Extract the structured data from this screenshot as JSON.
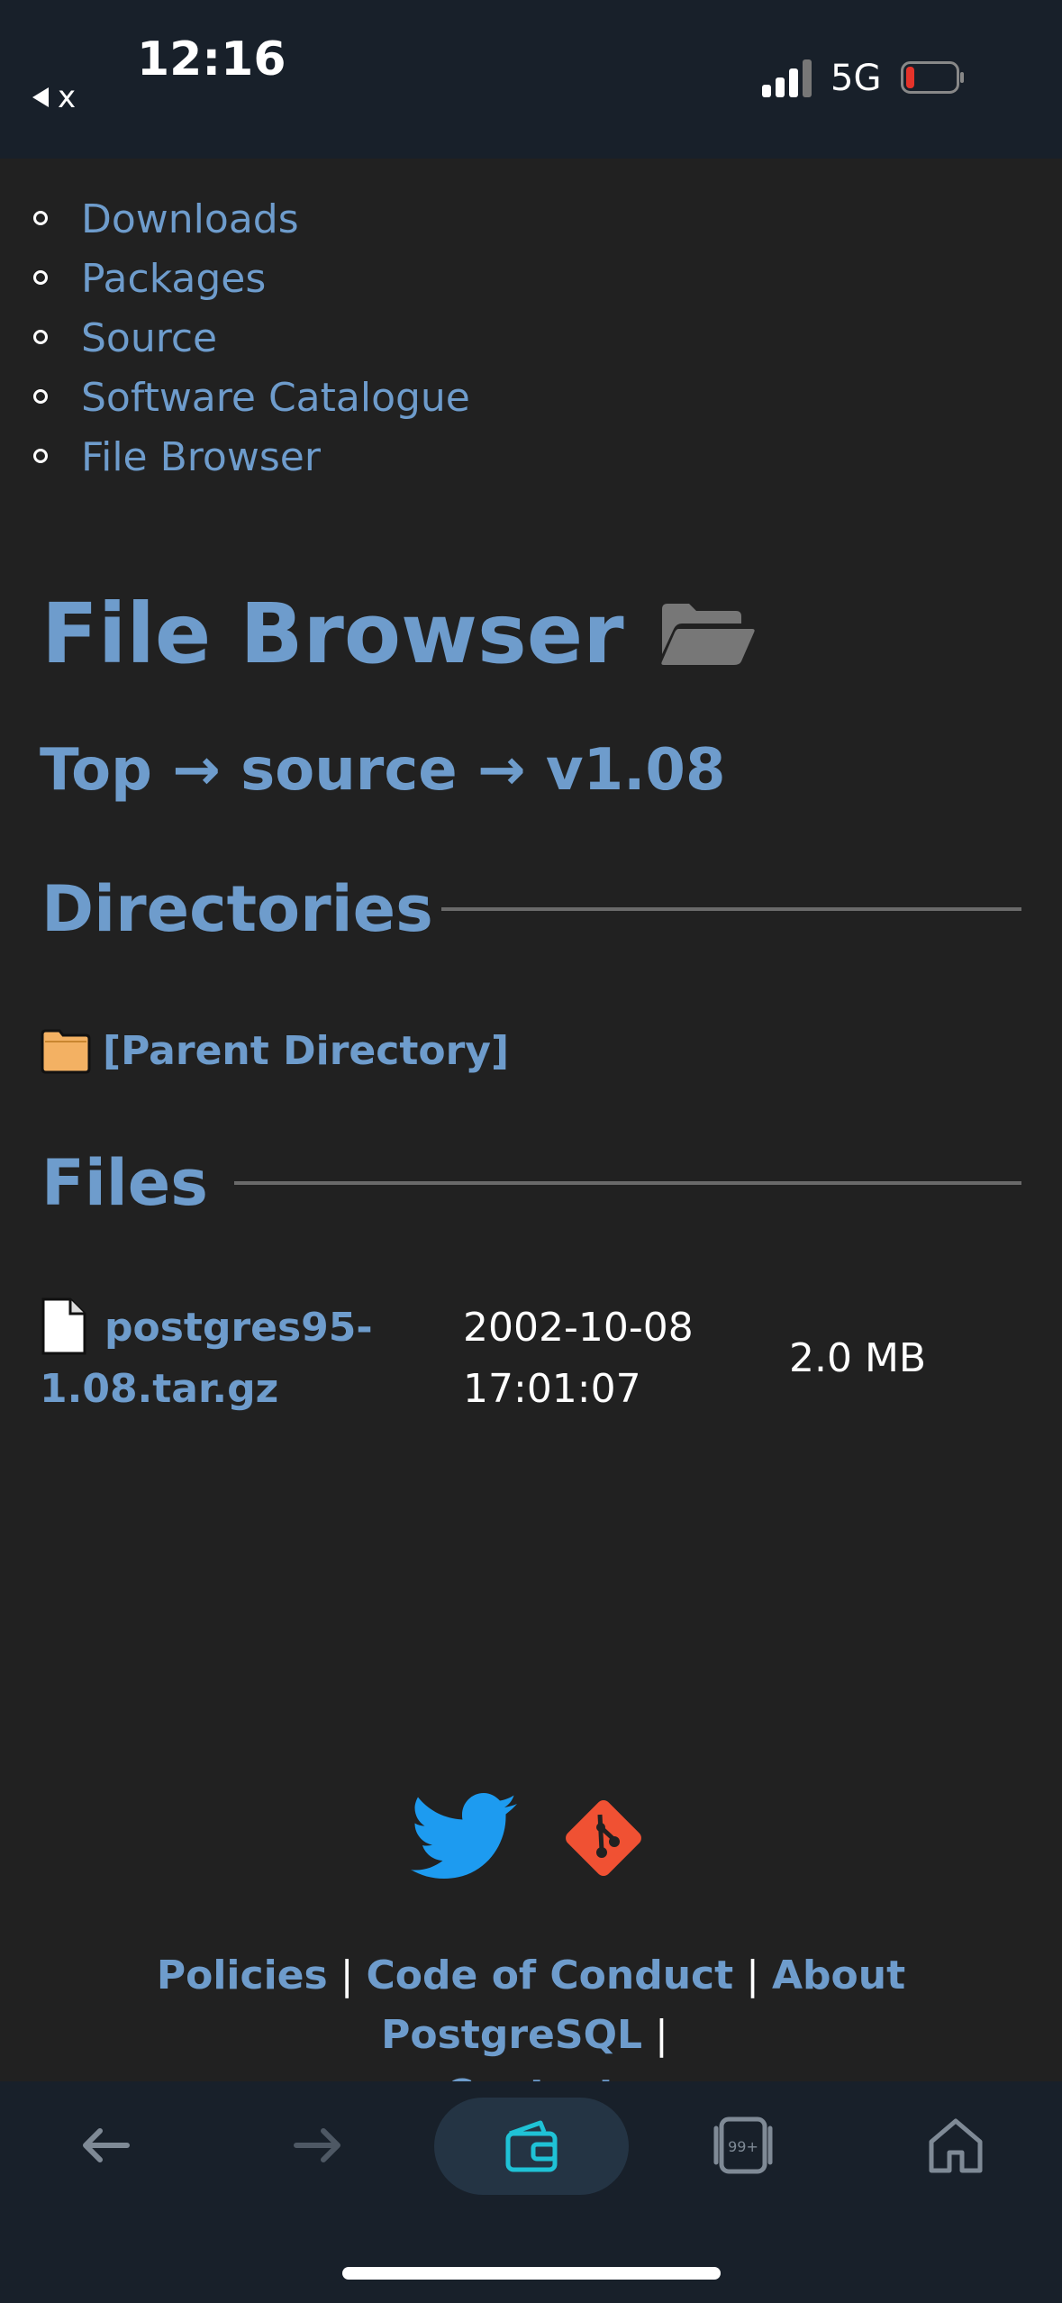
{
  "status_bar": {
    "back_label": "x",
    "time": "12:16",
    "network": "5G"
  },
  "nav": {
    "items": [
      {
        "label": "Downloads"
      },
      {
        "label": "Packages"
      },
      {
        "label": "Source"
      },
      {
        "label": "Software Catalogue"
      },
      {
        "label": "File Browser"
      }
    ]
  },
  "page": {
    "title": "File Browser",
    "breadcrumb": {
      "top": "Top",
      "source": "source",
      "current": "v1.08",
      "arrow": "→"
    }
  },
  "directories": {
    "heading": "Directories",
    "parent_label": "[Parent Directory]"
  },
  "files": {
    "heading": "Files",
    "rows": [
      {
        "name": "postgres95-1.08.tar.gz",
        "date": "2002-10-08 17:01:07",
        "size": "2.0 MB"
      }
    ]
  },
  "footer": {
    "policies": "Policies",
    "code_of_conduct": "Code of Conduct",
    "about": "About PostgreSQL",
    "contact": "Contact",
    "separator": "|"
  },
  "browser_bar": {
    "tabs_count": "99+"
  },
  "colors": {
    "link": "#6e9ccc",
    "background": "#212121",
    "bar": "#18202a",
    "twitter": "#1d9bf0",
    "git": "#f05133",
    "wallet_accent": "#1fc2d6"
  }
}
